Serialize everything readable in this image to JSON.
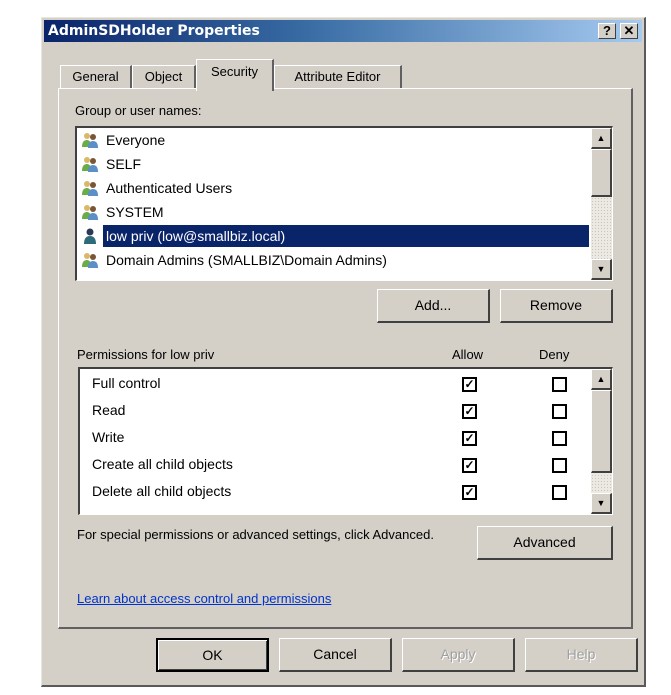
{
  "window": {
    "title": "AdminSDHolder Properties",
    "help_button": "?",
    "close_button": "✕"
  },
  "tabs": [
    {
      "label": "General",
      "active": false
    },
    {
      "label": "Object",
      "active": false
    },
    {
      "label": "Security",
      "active": true
    },
    {
      "label": "Attribute Editor",
      "active": false
    }
  ],
  "security": {
    "group_label": "Group or user names:",
    "principals": [
      {
        "name": "Everyone",
        "icon": "group-icon",
        "selected": false
      },
      {
        "name": "SELF",
        "icon": "group-icon",
        "selected": false
      },
      {
        "name": "Authenticated Users",
        "icon": "group-icon",
        "selected": false
      },
      {
        "name": "SYSTEM",
        "icon": "group-icon",
        "selected": false
      },
      {
        "name": "low priv (low@smallbiz.local)",
        "icon": "user-icon",
        "selected": true
      },
      {
        "name": "Domain Admins (SMALLBIZ\\Domain Admins)",
        "icon": "group-icon",
        "selected": false
      }
    ],
    "add_button": "Add...",
    "remove_button": "Remove",
    "permissions_label": "Permissions for low priv",
    "allow_header": "Allow",
    "deny_header": "Deny",
    "permissions": [
      {
        "name": "Full control",
        "allow": true,
        "deny": false
      },
      {
        "name": "Read",
        "allow": true,
        "deny": false
      },
      {
        "name": "Write",
        "allow": true,
        "deny": false
      },
      {
        "name": "Create all child objects",
        "allow": true,
        "deny": false
      },
      {
        "name": "Delete all child objects",
        "allow": true,
        "deny": false
      }
    ],
    "advanced_text": "For special permissions or advanced settings, click Advanced.",
    "advanced_button": "Advanced",
    "learn_link": "Learn about access control and permissions"
  },
  "footer": {
    "ok": "OK",
    "cancel": "Cancel",
    "apply": "Apply",
    "help": "Help"
  },
  "colors": {
    "selection": "#0a246a",
    "dialog_bg": "#d4d0c8",
    "link": "#0033cc"
  }
}
